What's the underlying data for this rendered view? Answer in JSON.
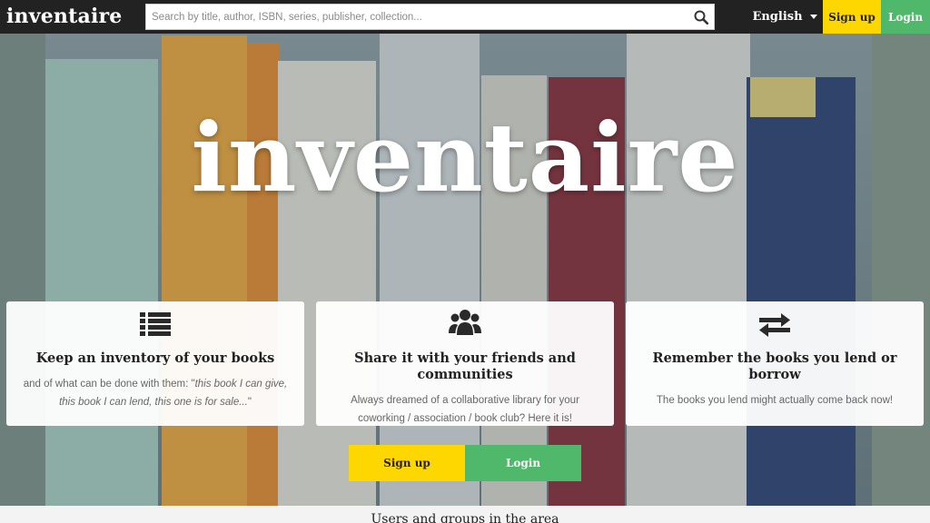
{
  "header": {
    "logo": "inventaire",
    "search_placeholder": "Search by title, author, ISBN, series, publisher, collection...",
    "search_icon": "search-icon",
    "language": "English",
    "signup_label": "Sign up",
    "login_label": "Login"
  },
  "hero": {
    "title": "inventaire"
  },
  "features": [
    {
      "icon": "list-icon",
      "title": "Keep an inventory of your books",
      "text_before": "and of what can be done with them: \"",
      "text_italic": "this book I can give, this book I can lend, this one is for sale...",
      "text_after": "\""
    },
    {
      "icon": "users-icon",
      "title": "Share it with your friends and communities",
      "text": "Always dreamed of a collaborative library for your coworking / association / book club? Here it is!"
    },
    {
      "icon": "exchange-icon",
      "title": "Remember the books you lend or borrow",
      "text": "The books you lend might actually come back now!"
    }
  ],
  "cta": {
    "signup_label": "Sign up",
    "login_label": "Login"
  },
  "section": {
    "users_groups_title": "Users and groups in the area"
  },
  "colors": {
    "topbar": "#222222",
    "signup": "#ffd700",
    "login": "#4fb86a"
  }
}
